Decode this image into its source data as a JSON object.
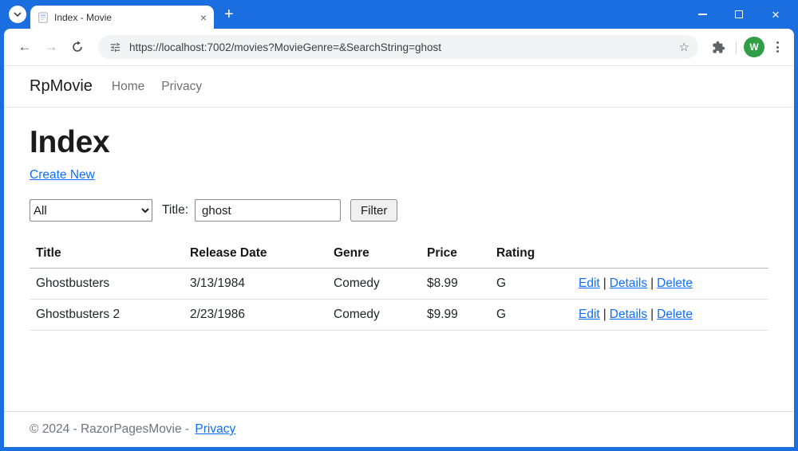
{
  "browser": {
    "tab_title": "Index - Movie",
    "url": "https://localhost:7002/movies?MovieGenre=&SearchString=ghost",
    "profile_initial": "W",
    "glyphs": {
      "new_tab": "+",
      "tab_close": "×",
      "close_window": "×",
      "back": "←",
      "forward": "→",
      "star": "☆"
    }
  },
  "site": {
    "navbar": {
      "brand": "RpMovie",
      "links": [
        {
          "label": "Home"
        },
        {
          "label": "Privacy"
        }
      ]
    },
    "page_title": "Index",
    "create_new_label": "Create New",
    "filter": {
      "genre_selected": "All",
      "title_label": "Title:",
      "search_value": "ghost",
      "button_label": "Filter"
    },
    "table": {
      "headers": [
        "Title",
        "Release Date",
        "Genre",
        "Price",
        "Rating"
      ],
      "action_separator": "|",
      "rows": [
        {
          "title": "Ghostbusters",
          "release_date": "3/13/1984",
          "genre": "Comedy",
          "price": "$8.99",
          "rating": "G",
          "actions": {
            "edit": "Edit",
            "details": "Details",
            "delete": "Delete"
          }
        },
        {
          "title": "Ghostbusters 2",
          "release_date": "2/23/1986",
          "genre": "Comedy",
          "price": "$9.99",
          "rating": "G",
          "actions": {
            "edit": "Edit",
            "details": "Details",
            "delete": "Delete"
          }
        }
      ]
    },
    "footer": {
      "copyright": "© 2024 - RazorPagesMovie -",
      "privacy_label": "Privacy"
    }
  },
  "colors": {
    "chrome_frame_blue": "#1a6ee0",
    "link_blue": "#0d6efd",
    "avatar_green": "#2f9e44",
    "omnibox_gray": "#f1f3f4"
  }
}
